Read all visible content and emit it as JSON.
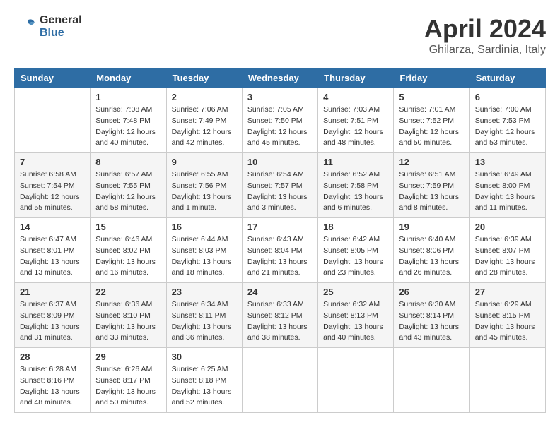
{
  "header": {
    "logo_general": "General",
    "logo_blue": "Blue",
    "month_year": "April 2024",
    "location": "Ghilarza, Sardinia, Italy"
  },
  "columns": [
    "Sunday",
    "Monday",
    "Tuesday",
    "Wednesday",
    "Thursday",
    "Friday",
    "Saturday"
  ],
  "weeks": [
    [
      {
        "day": "",
        "sunrise": "",
        "sunset": "",
        "daylight": ""
      },
      {
        "day": "1",
        "sunrise": "Sunrise: 7:08 AM",
        "sunset": "Sunset: 7:48 PM",
        "daylight": "Daylight: 12 hours and 40 minutes."
      },
      {
        "day": "2",
        "sunrise": "Sunrise: 7:06 AM",
        "sunset": "Sunset: 7:49 PM",
        "daylight": "Daylight: 12 hours and 42 minutes."
      },
      {
        "day": "3",
        "sunrise": "Sunrise: 7:05 AM",
        "sunset": "Sunset: 7:50 PM",
        "daylight": "Daylight: 12 hours and 45 minutes."
      },
      {
        "day": "4",
        "sunrise": "Sunrise: 7:03 AM",
        "sunset": "Sunset: 7:51 PM",
        "daylight": "Daylight: 12 hours and 48 minutes."
      },
      {
        "day": "5",
        "sunrise": "Sunrise: 7:01 AM",
        "sunset": "Sunset: 7:52 PM",
        "daylight": "Daylight: 12 hours and 50 minutes."
      },
      {
        "day": "6",
        "sunrise": "Sunrise: 7:00 AM",
        "sunset": "Sunset: 7:53 PM",
        "daylight": "Daylight: 12 hours and 53 minutes."
      }
    ],
    [
      {
        "day": "7",
        "sunrise": "Sunrise: 6:58 AM",
        "sunset": "Sunset: 7:54 PM",
        "daylight": "Daylight: 12 hours and 55 minutes."
      },
      {
        "day": "8",
        "sunrise": "Sunrise: 6:57 AM",
        "sunset": "Sunset: 7:55 PM",
        "daylight": "Daylight: 12 hours and 58 minutes."
      },
      {
        "day": "9",
        "sunrise": "Sunrise: 6:55 AM",
        "sunset": "Sunset: 7:56 PM",
        "daylight": "Daylight: 13 hours and 1 minute."
      },
      {
        "day": "10",
        "sunrise": "Sunrise: 6:54 AM",
        "sunset": "Sunset: 7:57 PM",
        "daylight": "Daylight: 13 hours and 3 minutes."
      },
      {
        "day": "11",
        "sunrise": "Sunrise: 6:52 AM",
        "sunset": "Sunset: 7:58 PM",
        "daylight": "Daylight: 13 hours and 6 minutes."
      },
      {
        "day": "12",
        "sunrise": "Sunrise: 6:51 AM",
        "sunset": "Sunset: 7:59 PM",
        "daylight": "Daylight: 13 hours and 8 minutes."
      },
      {
        "day": "13",
        "sunrise": "Sunrise: 6:49 AM",
        "sunset": "Sunset: 8:00 PM",
        "daylight": "Daylight: 13 hours and 11 minutes."
      }
    ],
    [
      {
        "day": "14",
        "sunrise": "Sunrise: 6:47 AM",
        "sunset": "Sunset: 8:01 PM",
        "daylight": "Daylight: 13 hours and 13 minutes."
      },
      {
        "day": "15",
        "sunrise": "Sunrise: 6:46 AM",
        "sunset": "Sunset: 8:02 PM",
        "daylight": "Daylight: 13 hours and 16 minutes."
      },
      {
        "day": "16",
        "sunrise": "Sunrise: 6:44 AM",
        "sunset": "Sunset: 8:03 PM",
        "daylight": "Daylight: 13 hours and 18 minutes."
      },
      {
        "day": "17",
        "sunrise": "Sunrise: 6:43 AM",
        "sunset": "Sunset: 8:04 PM",
        "daylight": "Daylight: 13 hours and 21 minutes."
      },
      {
        "day": "18",
        "sunrise": "Sunrise: 6:42 AM",
        "sunset": "Sunset: 8:05 PM",
        "daylight": "Daylight: 13 hours and 23 minutes."
      },
      {
        "day": "19",
        "sunrise": "Sunrise: 6:40 AM",
        "sunset": "Sunset: 8:06 PM",
        "daylight": "Daylight: 13 hours and 26 minutes."
      },
      {
        "day": "20",
        "sunrise": "Sunrise: 6:39 AM",
        "sunset": "Sunset: 8:07 PM",
        "daylight": "Daylight: 13 hours and 28 minutes."
      }
    ],
    [
      {
        "day": "21",
        "sunrise": "Sunrise: 6:37 AM",
        "sunset": "Sunset: 8:09 PM",
        "daylight": "Daylight: 13 hours and 31 minutes."
      },
      {
        "day": "22",
        "sunrise": "Sunrise: 6:36 AM",
        "sunset": "Sunset: 8:10 PM",
        "daylight": "Daylight: 13 hours and 33 minutes."
      },
      {
        "day": "23",
        "sunrise": "Sunrise: 6:34 AM",
        "sunset": "Sunset: 8:11 PM",
        "daylight": "Daylight: 13 hours and 36 minutes."
      },
      {
        "day": "24",
        "sunrise": "Sunrise: 6:33 AM",
        "sunset": "Sunset: 8:12 PM",
        "daylight": "Daylight: 13 hours and 38 minutes."
      },
      {
        "day": "25",
        "sunrise": "Sunrise: 6:32 AM",
        "sunset": "Sunset: 8:13 PM",
        "daylight": "Daylight: 13 hours and 40 minutes."
      },
      {
        "day": "26",
        "sunrise": "Sunrise: 6:30 AM",
        "sunset": "Sunset: 8:14 PM",
        "daylight": "Daylight: 13 hours and 43 minutes."
      },
      {
        "day": "27",
        "sunrise": "Sunrise: 6:29 AM",
        "sunset": "Sunset: 8:15 PM",
        "daylight": "Daylight: 13 hours and 45 minutes."
      }
    ],
    [
      {
        "day": "28",
        "sunrise": "Sunrise: 6:28 AM",
        "sunset": "Sunset: 8:16 PM",
        "daylight": "Daylight: 13 hours and 48 minutes."
      },
      {
        "day": "29",
        "sunrise": "Sunrise: 6:26 AM",
        "sunset": "Sunset: 8:17 PM",
        "daylight": "Daylight: 13 hours and 50 minutes."
      },
      {
        "day": "30",
        "sunrise": "Sunrise: 6:25 AM",
        "sunset": "Sunset: 8:18 PM",
        "daylight": "Daylight: 13 hours and 52 minutes."
      },
      {
        "day": "",
        "sunrise": "",
        "sunset": "",
        "daylight": ""
      },
      {
        "day": "",
        "sunrise": "",
        "sunset": "",
        "daylight": ""
      },
      {
        "day": "",
        "sunrise": "",
        "sunset": "",
        "daylight": ""
      },
      {
        "day": "",
        "sunrise": "",
        "sunset": "",
        "daylight": ""
      }
    ]
  ]
}
